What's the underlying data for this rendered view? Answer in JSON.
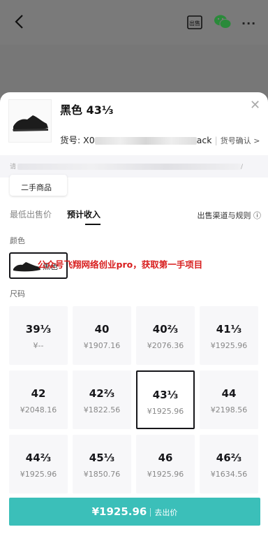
{
  "topbar": {
    "icons": [
      "back-icon",
      "sell-icon",
      "wechat-icon",
      "more-icon"
    ],
    "sell_icon_text": "出售",
    "more_text": "···"
  },
  "product": {
    "title": "黑色 43⅓",
    "sku_prefix": "货号: X0",
    "sku_suffix": "ack",
    "sku_confirm": "货号确认 >"
  },
  "notice": {
    "prefix": "请",
    "suffix": "/"
  },
  "partial_card": {
    "label": "二手商品"
  },
  "tabs": [
    {
      "label": "最低出售价",
      "active": false
    },
    {
      "label": "预计收入",
      "active": true
    }
  ],
  "channel_link": "出售渠道与规则 ⓘ",
  "color": {
    "label": "颜色",
    "selected": "黑色"
  },
  "watermark": "公众号飞翔网络创业pro，获取第一手项目",
  "sizes": {
    "label": "尺码",
    "items": [
      {
        "size": "39⅓",
        "price": "¥--"
      },
      {
        "size": "40",
        "price": "¥1907.16"
      },
      {
        "size": "40⅔",
        "price": "¥2076.36"
      },
      {
        "size": "41⅓",
        "price": "¥1925.96"
      },
      {
        "size": "42",
        "price": "¥2048.16"
      },
      {
        "size": "42⅔",
        "price": "¥1822.56"
      },
      {
        "size": "43⅓",
        "price": "¥1925.96",
        "selected": true
      },
      {
        "size": "44",
        "price": "¥2198.56"
      },
      {
        "size": "44⅔",
        "price": "¥1925.96"
      },
      {
        "size": "45⅓",
        "price": "¥1850.76"
      },
      {
        "size": "46",
        "price": "¥1925.96"
      },
      {
        "size": "46⅔",
        "price": "¥1634.56"
      }
    ]
  },
  "cta": {
    "amount": "¥1925.96",
    "action": "去出价"
  },
  "colors": {
    "accent": "#3bbfb9",
    "watermark": "#d81e1e",
    "overlay": "#7a7a7a"
  }
}
